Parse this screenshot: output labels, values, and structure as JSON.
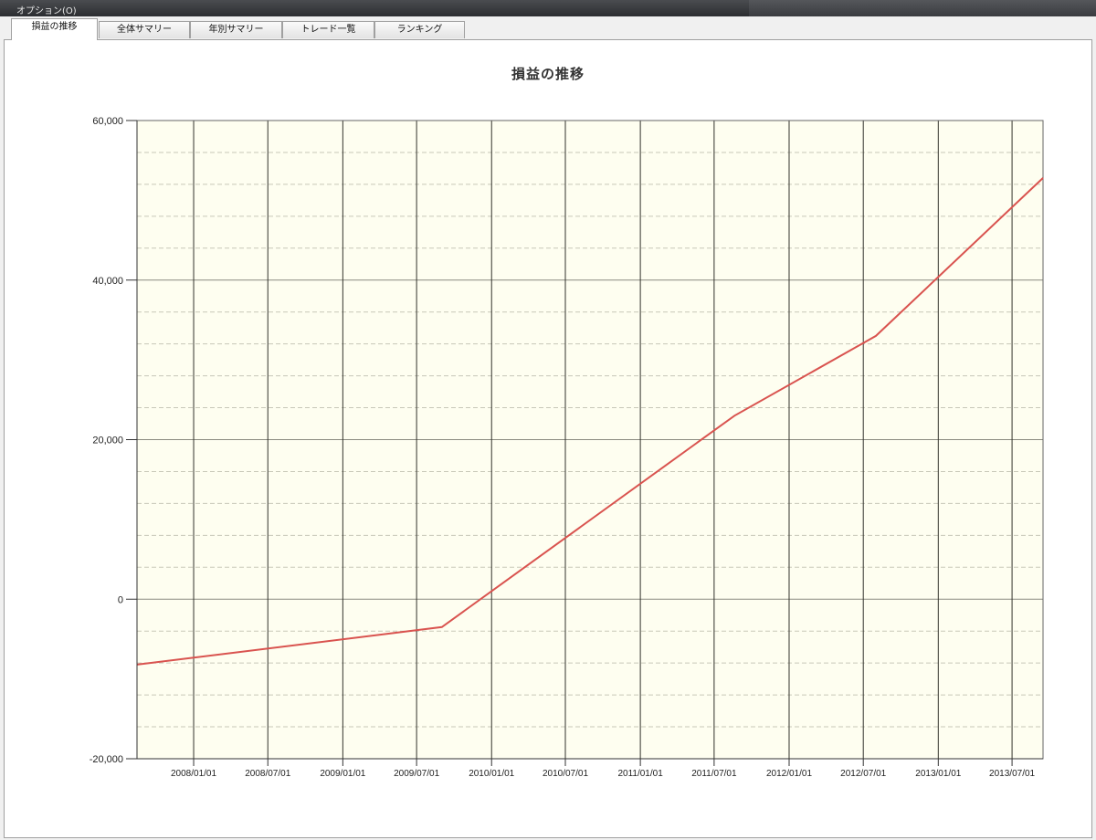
{
  "menubar": {
    "options_label": "オプション(O)"
  },
  "tabs": [
    {
      "label": "損益の推移",
      "active": true
    },
    {
      "label": "全体サマリー",
      "active": false
    },
    {
      "label": "年別サマリー",
      "active": false
    },
    {
      "label": "トレード一覧",
      "active": false
    },
    {
      "label": "ランキング",
      "active": false
    }
  ],
  "colors": {
    "plot_background": "#fefef0",
    "line": "#d9534f"
  },
  "chart_data": {
    "type": "line",
    "title": "損益の推移",
    "xlabel": "",
    "ylabel": "",
    "ylim": [
      -20000,
      60000
    ],
    "yticks": [
      -20000,
      0,
      20000,
      40000,
      60000
    ],
    "ytick_labels": [
      "-20,000",
      "0",
      "20,000",
      "40,000",
      "60,000"
    ],
    "xlim": [
      "2007-08-15",
      "2013-09-15"
    ],
    "xticks": [
      "2008/01/01",
      "2008/07/01",
      "2009/01/01",
      "2009/07/01",
      "2010/01/01",
      "2010/07/01",
      "2011/01/01",
      "2011/07/01",
      "2012/01/01",
      "2012/07/01",
      "2013/01/01",
      "2013/07/01"
    ],
    "grid": true,
    "legend": "none",
    "series": [
      {
        "x": [
          "2007-08-15",
          "2009-09-01",
          "2011-08-20",
          "2012-08-01",
          "2013-09-15"
        ],
        "y": [
          -8200,
          -3500,
          23000,
          33000,
          52800
        ]
      }
    ]
  }
}
